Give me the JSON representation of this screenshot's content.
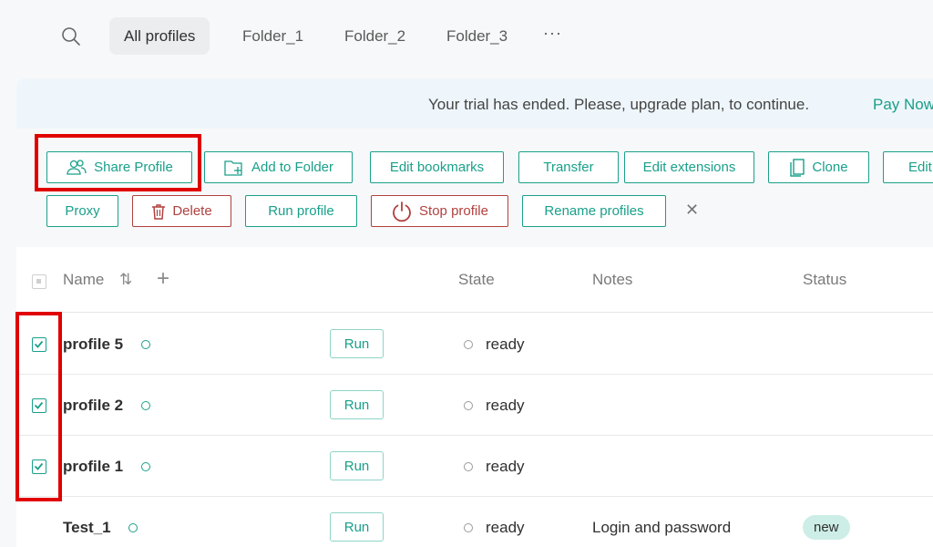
{
  "nav": {
    "tabs": [
      {
        "label": "All profiles",
        "active": true
      },
      {
        "label": "Folder_1"
      },
      {
        "label": "Folder_2"
      },
      {
        "label": "Folder_3"
      }
    ],
    "more": "···"
  },
  "banner": {
    "text": "Your trial has ended. Please, upgrade plan, to continue.",
    "link": "Pay Now"
  },
  "toolbar": {
    "share_profile": "Share Profile",
    "add_to_folder": "Add to Folder",
    "edit_bookmarks": "Edit bookmarks",
    "transfer": "Transfer",
    "edit_extensions": "Edit extensions",
    "clone": "Clone",
    "edit_truncated": "Edit",
    "proxy": "Proxy",
    "delete": "Delete",
    "run_profile": "Run profile",
    "stop_profile": "Stop profile",
    "rename_profiles": "Rename profiles",
    "close": "✕"
  },
  "table": {
    "headers": {
      "name": "Name",
      "sort": "⇅",
      "add": "+",
      "state": "State",
      "notes": "Notes",
      "status": "Status"
    },
    "rows": [
      {
        "name": "profile 5",
        "checked": true,
        "run": "Run",
        "state": "ready",
        "notes": "",
        "status": ""
      },
      {
        "name": "profile 2",
        "checked": true,
        "run": "Run",
        "state": "ready",
        "notes": "",
        "status": ""
      },
      {
        "name": "profile 1",
        "checked": true,
        "run": "Run",
        "state": "ready",
        "notes": "",
        "status": ""
      },
      {
        "name": "Test_1",
        "checked": false,
        "run": "Run",
        "state": "ready",
        "notes": "Login and password",
        "status": "new"
      }
    ]
  },
  "colors": {
    "accent": "#1aa08a",
    "danger": "#b0413e",
    "highlight": "#e00000",
    "banner_bg": "#eef6fb"
  }
}
